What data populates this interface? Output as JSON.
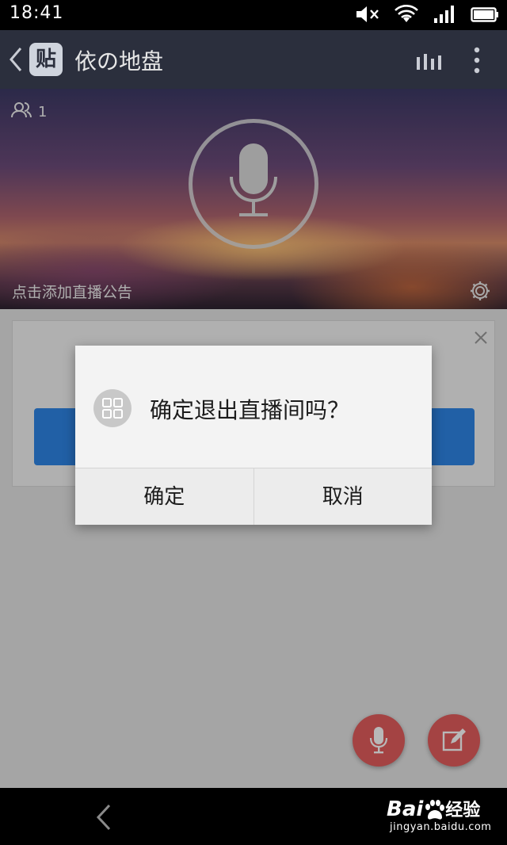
{
  "status_bar": {
    "time": "18:41",
    "icons": [
      "mute-icon",
      "wifi-icon",
      "signal-icon",
      "battery-icon"
    ]
  },
  "header": {
    "logo_text": "贴",
    "title": "依の地盘",
    "icons": [
      "back-icon",
      "stats-icon",
      "more-icon"
    ]
  },
  "banner": {
    "user_count": "1",
    "announcement": "点击添加直播公告",
    "icons": [
      "users-icon",
      "microphone-icon",
      "gear-icon"
    ]
  },
  "dialog": {
    "message": "确定退出直播间吗？",
    "confirm_label": "确定",
    "cancel_label": "取消",
    "icon": "grid-icon"
  },
  "fab": {
    "icons": [
      "microphone-icon",
      "edit-icon"
    ]
  },
  "watermark": {
    "logo": "Bai",
    "logo_suffix": "经验",
    "url": "jingyan.baidu.com"
  },
  "colors": {
    "header_bg": "#2b2f3d",
    "accent_blue": "#2f85e6",
    "fab_red": "#e45d5d"
  }
}
